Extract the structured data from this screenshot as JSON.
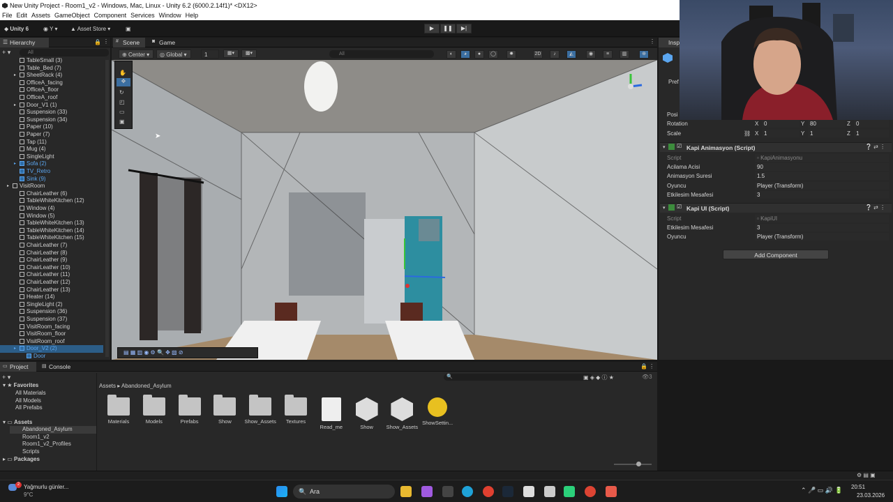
{
  "window": {
    "title": "New Unity Project - Room1_v2 - Windows, Mac, Linux - Unity 6.2 (6000.2.14f1)* <DX12>"
  },
  "menu": [
    "File",
    "Edit",
    "Assets",
    "GameObject",
    "Component",
    "Services",
    "Window",
    "Help"
  ],
  "toolbar": {
    "unity_label": "Unity 6",
    "account_label": "Y",
    "asset_store_label": "Asset Store"
  },
  "hierarchy": {
    "tab_label": "Hierarchy",
    "search_placeholder": "All",
    "rows": [
      {
        "label": "TableSmall (3)",
        "indent": 2,
        "arrow": false,
        "blue": false,
        "sel": false
      },
      {
        "label": "Table_Bed (7)",
        "indent": 2,
        "arrow": false,
        "blue": false,
        "sel": false
      },
      {
        "label": "SheetRack (4)",
        "indent": 2,
        "arrow": true,
        "blue": false,
        "sel": false
      },
      {
        "label": "OfficeA_facing",
        "indent": 2,
        "arrow": false,
        "blue": false,
        "sel": false
      },
      {
        "label": "OfficeA_floor",
        "indent": 2,
        "arrow": false,
        "blue": false,
        "sel": false
      },
      {
        "label": "OfficeA_roof",
        "indent": 2,
        "arrow": false,
        "blue": false,
        "sel": false
      },
      {
        "label": "Door_V1 (1)",
        "indent": 2,
        "arrow": true,
        "blue": false,
        "sel": false
      },
      {
        "label": "Suspension (33)",
        "indent": 2,
        "arrow": false,
        "blue": false,
        "sel": false
      },
      {
        "label": "Suspension (34)",
        "indent": 2,
        "arrow": false,
        "blue": false,
        "sel": false
      },
      {
        "label": "Paper (10)",
        "indent": 2,
        "arrow": false,
        "blue": false,
        "sel": false
      },
      {
        "label": "Paper (7)",
        "indent": 2,
        "arrow": false,
        "blue": false,
        "sel": false
      },
      {
        "label": "Tap (11)",
        "indent": 2,
        "arrow": false,
        "blue": false,
        "sel": false
      },
      {
        "label": "Mug (4)",
        "indent": 2,
        "arrow": false,
        "blue": false,
        "sel": false
      },
      {
        "label": "SingleLight",
        "indent": 2,
        "arrow": false,
        "blue": false,
        "sel": false
      },
      {
        "label": "Sofa (2)",
        "indent": 2,
        "arrow": true,
        "blue": true,
        "sel": false
      },
      {
        "label": "TV_Retro",
        "indent": 2,
        "arrow": false,
        "blue": true,
        "sel": false
      },
      {
        "label": "Sink (9)",
        "indent": 2,
        "arrow": false,
        "blue": true,
        "sel": false
      },
      {
        "label": "VisitRoom",
        "indent": 1,
        "arrow": true,
        "blue": false,
        "sel": false
      },
      {
        "label": "ChairLeather (6)",
        "indent": 2,
        "arrow": false,
        "blue": false,
        "sel": false
      },
      {
        "label": "TableWhiteKitchen (12)",
        "indent": 2,
        "arrow": false,
        "blue": false,
        "sel": false
      },
      {
        "label": "Window (4)",
        "indent": 2,
        "arrow": false,
        "blue": false,
        "sel": false
      },
      {
        "label": "Window (5)",
        "indent": 2,
        "arrow": false,
        "blue": false,
        "sel": false
      },
      {
        "label": "TableWhiteKitchen (13)",
        "indent": 2,
        "arrow": false,
        "blue": false,
        "sel": false
      },
      {
        "label": "TableWhiteKitchen (14)",
        "indent": 2,
        "arrow": false,
        "blue": false,
        "sel": false
      },
      {
        "label": "TableWhiteKitchen (15)",
        "indent": 2,
        "arrow": false,
        "blue": false,
        "sel": false
      },
      {
        "label": "ChairLeather (7)",
        "indent": 2,
        "arrow": false,
        "blue": false,
        "sel": false
      },
      {
        "label": "ChairLeather (8)",
        "indent": 2,
        "arrow": false,
        "blue": false,
        "sel": false
      },
      {
        "label": "ChairLeather (9)",
        "indent": 2,
        "arrow": false,
        "blue": false,
        "sel": false
      },
      {
        "label": "ChairLeather (10)",
        "indent": 2,
        "arrow": false,
        "blue": false,
        "sel": false
      },
      {
        "label": "ChairLeather (11)",
        "indent": 2,
        "arrow": false,
        "blue": false,
        "sel": false
      },
      {
        "label": "ChairLeather (12)",
        "indent": 2,
        "arrow": false,
        "blue": false,
        "sel": false
      },
      {
        "label": "ChairLeather (13)",
        "indent": 2,
        "arrow": false,
        "blue": false,
        "sel": false
      },
      {
        "label": "Heater (14)",
        "indent": 2,
        "arrow": false,
        "blue": false,
        "sel": false
      },
      {
        "label": "SingleLight (2)",
        "indent": 2,
        "arrow": false,
        "blue": false,
        "sel": false
      },
      {
        "label": "Suspension (36)",
        "indent": 2,
        "arrow": false,
        "blue": false,
        "sel": false
      },
      {
        "label": "Suspension (37)",
        "indent": 2,
        "arrow": false,
        "blue": false,
        "sel": false
      },
      {
        "label": "VisitRoom_facing",
        "indent": 2,
        "arrow": false,
        "blue": false,
        "sel": false
      },
      {
        "label": "VisitRoom_floor",
        "indent": 2,
        "arrow": false,
        "blue": false,
        "sel": false
      },
      {
        "label": "VisitRoom_roof",
        "indent": 2,
        "arrow": false,
        "blue": false,
        "sel": false
      },
      {
        "label": "Door_V2 (2)",
        "indent": 2,
        "arrow": true,
        "blue": true,
        "sel": true
      },
      {
        "label": "Door",
        "indent": 3,
        "arrow": false,
        "blue": true,
        "sel": false
      }
    ]
  },
  "scene": {
    "tab_scene": "Scene",
    "tab_game": "Game",
    "pivot_label": "Center",
    "space_label": "Global",
    "grid_value": "1",
    "search_placeholder": "All"
  },
  "inspector": {
    "tab_label": "Insp",
    "prefab_label": "Pref",
    "position_label": "Posi",
    "rotation_label": "Rotation",
    "rotation": {
      "x": "0",
      "y": "80",
      "z": "0"
    },
    "scale_label": "Scale",
    "scale": {
      "x": "1",
      "y": "1",
      "z": "1"
    },
    "component1": {
      "title": "Kapi Animasyon (Script)",
      "script_label": "Script",
      "script_value": "KapiAnimasyonu",
      "fields": [
        {
          "label": "Acilama Acisi",
          "value": "90"
        },
        {
          "label": "Animasyon Suresi",
          "value": "1.5"
        },
        {
          "label": "Oyuncu",
          "value": "Player (Transform)"
        },
        {
          "label": "Etkilesim Mesafesi",
          "value": "3"
        }
      ]
    },
    "component2": {
      "title": "Kapi UI (Script)",
      "script_label": "Script",
      "script_value": "KapiUI",
      "fields": [
        {
          "label": "Etkilesim Mesafesi",
          "value": "3"
        },
        {
          "label": "Oyuncu",
          "value": "Player (Transform)"
        }
      ]
    },
    "add_component_label": "Add Component"
  },
  "project": {
    "tab_project": "Project",
    "tab_console": "Console",
    "favorites_label": "Favorites",
    "favorites": [
      "All Materials",
      "All Models",
      "All Prefabs"
    ],
    "assets_label": "Assets",
    "asset_folders": [
      "Abandoned_Asylum",
      "Room1_v2",
      "Room1_v2_Profiles",
      "Scripts"
    ],
    "packages_label": "Packages",
    "breadcrumb_root": "Assets",
    "breadcrumb_current": "Abandoned_Asylum",
    "hidden_count": "3",
    "items": [
      {
        "label": "Materials",
        "kind": "folder"
      },
      {
        "label": "Models",
        "kind": "folder"
      },
      {
        "label": "Prefabs",
        "kind": "folder"
      },
      {
        "label": "Show",
        "kind": "folder"
      },
      {
        "label": "Show_Assets",
        "kind": "folder"
      },
      {
        "label": "Textures",
        "kind": "folder"
      },
      {
        "label": "Read_me",
        "kind": "doc"
      },
      {
        "label": "Show",
        "kind": "unity"
      },
      {
        "label": "Show_Assets",
        "kind": "unity"
      },
      {
        "label": "ShowSettin...",
        "kind": "settings"
      }
    ]
  },
  "taskbar": {
    "weather_text": "Yağmurlu günler...",
    "temperature": "9°C",
    "weather_badge": "2",
    "search_label": "Ara",
    "time": "20:51",
    "date": "23.03.2026"
  },
  "colors": {
    "accent_blue": "#5ba6f0",
    "selection": "#2c5d87",
    "panel_bg": "#282828"
  }
}
